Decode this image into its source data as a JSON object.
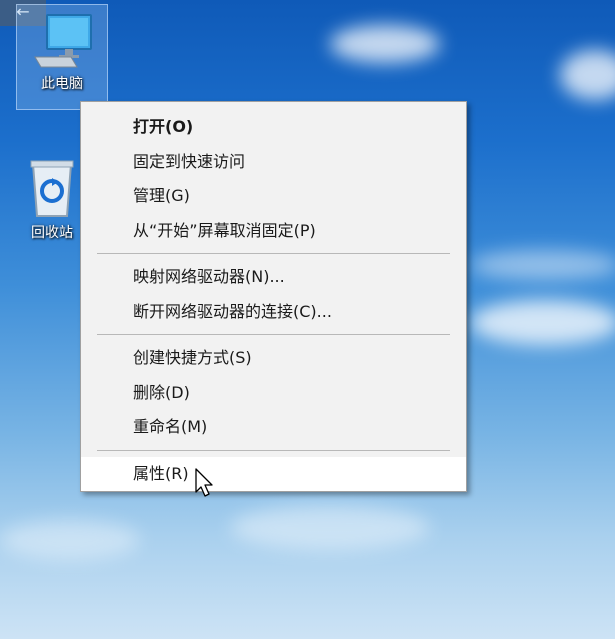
{
  "toolbar": {
    "back_glyph": "←"
  },
  "desktop": {
    "icons": [
      {
        "label": "此电脑",
        "icon": "computer-icon"
      },
      {
        "label": "回收站",
        "icon": "recycle-bin-icon"
      }
    ]
  },
  "context_menu": {
    "items": [
      {
        "label": "打开(O)",
        "bold": true
      },
      {
        "label": "固定到快速访问"
      },
      {
        "label": "管理(G)"
      },
      {
        "label": "从“开始”屏幕取消固定(P)"
      },
      {
        "label": "映射网络驱动器(N)..."
      },
      {
        "label": "断开网络驱动器的连接(C)..."
      },
      {
        "label": "创建快捷方式(S)"
      },
      {
        "label": "删除(D)"
      },
      {
        "label": "重命名(M)"
      },
      {
        "label": "属性(R)",
        "highlighted": true
      }
    ]
  },
  "colors": {
    "menu_background": "#f2f2f2",
    "highlight_background": "#ffffff",
    "desktop_top": "#0f5ab8",
    "desktop_bottom": "#cde3f5"
  }
}
